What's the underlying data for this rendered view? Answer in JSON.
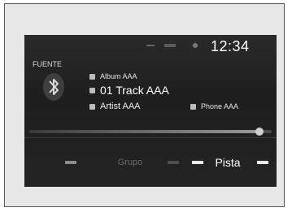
{
  "status": {
    "clock": "12:34",
    "icons": [
      "signal-icon",
      "battery-icon",
      "bluetooth-status-icon"
    ]
  },
  "source": {
    "label": "FUENTE",
    "icon": "bluetooth-icon"
  },
  "now_playing": {
    "album": "Album AAA",
    "track": "01 Track AAA",
    "artist": "Artist AAA",
    "phone": "Phone AAA"
  },
  "progress": {
    "fraction": 0.95
  },
  "controls": {
    "group_label": "Grupo",
    "track_label": "Pista"
  },
  "colors": {
    "screen_bg": "#232323",
    "text": "#ffffff",
    "inactive_text": "#6b6b6b"
  }
}
